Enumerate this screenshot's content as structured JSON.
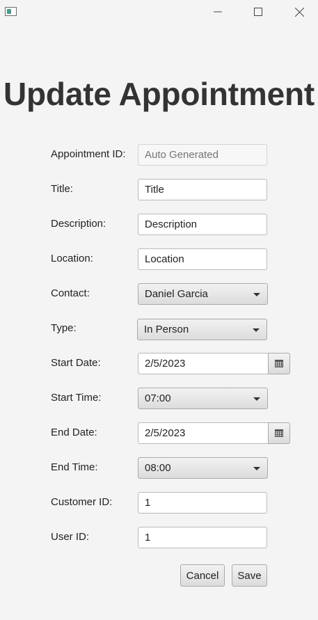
{
  "window": {
    "icons": {
      "app": "window-app-icon",
      "minimize": "minimize-icon",
      "maximize": "maximize-icon",
      "close": "close-icon"
    }
  },
  "page": {
    "title": "Update Appointment"
  },
  "form": {
    "appointment_id": {
      "label": "Appointment ID:",
      "value": "",
      "placeholder": "Auto Generated"
    },
    "title": {
      "label": "Title:",
      "value": "Title"
    },
    "description": {
      "label": "Description:",
      "value": "Description"
    },
    "location": {
      "label": "Location:",
      "value": "Location"
    },
    "contact": {
      "label": "Contact:",
      "selected": "Daniel Garcia"
    },
    "type": {
      "label": "Type:",
      "selected": "In Person"
    },
    "start_date": {
      "label": "Start Date:",
      "value": "2/5/2023",
      "icon": "calendar-icon"
    },
    "start_time": {
      "label": "Start Time:",
      "selected": "07:00"
    },
    "end_date": {
      "label": "End Date:",
      "value": "2/5/2023",
      "icon": "calendar-icon"
    },
    "end_time": {
      "label": "End Time:",
      "selected": "08:00"
    },
    "customer_id": {
      "label": "Customer ID:",
      "value": "1"
    },
    "user_id": {
      "label": "User ID:",
      "value": "1"
    }
  },
  "buttons": {
    "cancel": "Cancel",
    "save": "Save"
  }
}
